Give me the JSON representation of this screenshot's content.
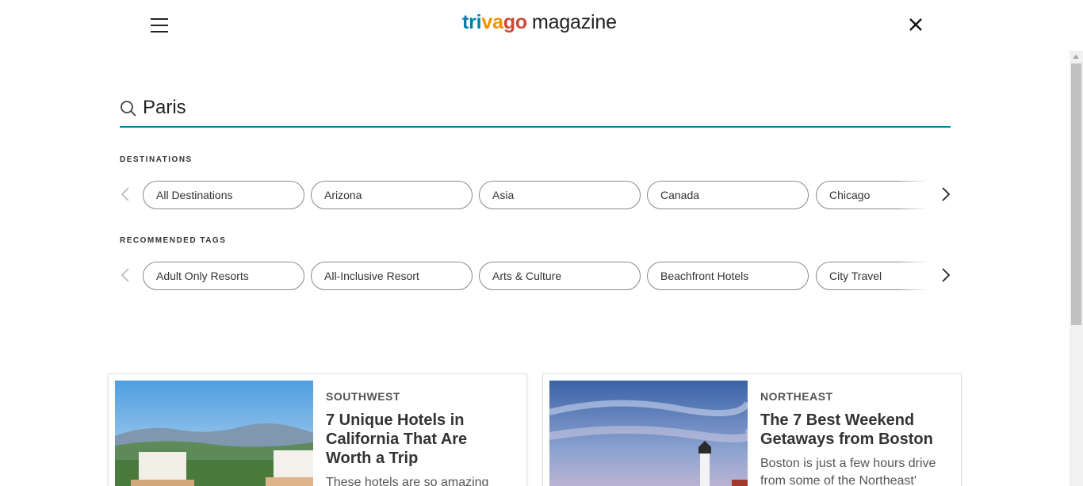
{
  "header": {
    "logo_parts": [
      "tri",
      "va",
      "go"
    ],
    "logo_suffix": "magazine",
    "menu_icon": "hamburger-menu-icon",
    "close_icon": "close-icon"
  },
  "search": {
    "value": "Paris",
    "icon": "search-icon"
  },
  "destinations": {
    "title": "DESTINATIONS",
    "chips": [
      "All Destinations",
      "Arizona",
      "Asia",
      "Canada",
      "Chicago"
    ]
  },
  "tags": {
    "title": "RECOMMENDED TAGS",
    "chips": [
      "Adult Only Resorts",
      "All-Inclusive Resort",
      "Arts & Culture",
      "Beachfront Hotels",
      "City Travel"
    ]
  },
  "articles": [
    {
      "category": "SOUTHWEST",
      "title": "7 Unique Hotels in California That Are Worth a Trip",
      "excerpt": "These hotels are so amazing"
    },
    {
      "category": "NORTHEAST",
      "title": "The 7 Best Weekend Getaways from Boston",
      "excerpt": "Boston is just a few hours drive from some of the Northeast'"
    }
  ],
  "colors": {
    "accent": "#007fad",
    "logo_orange": "#f48f00",
    "logo_red": "#c94a38"
  }
}
